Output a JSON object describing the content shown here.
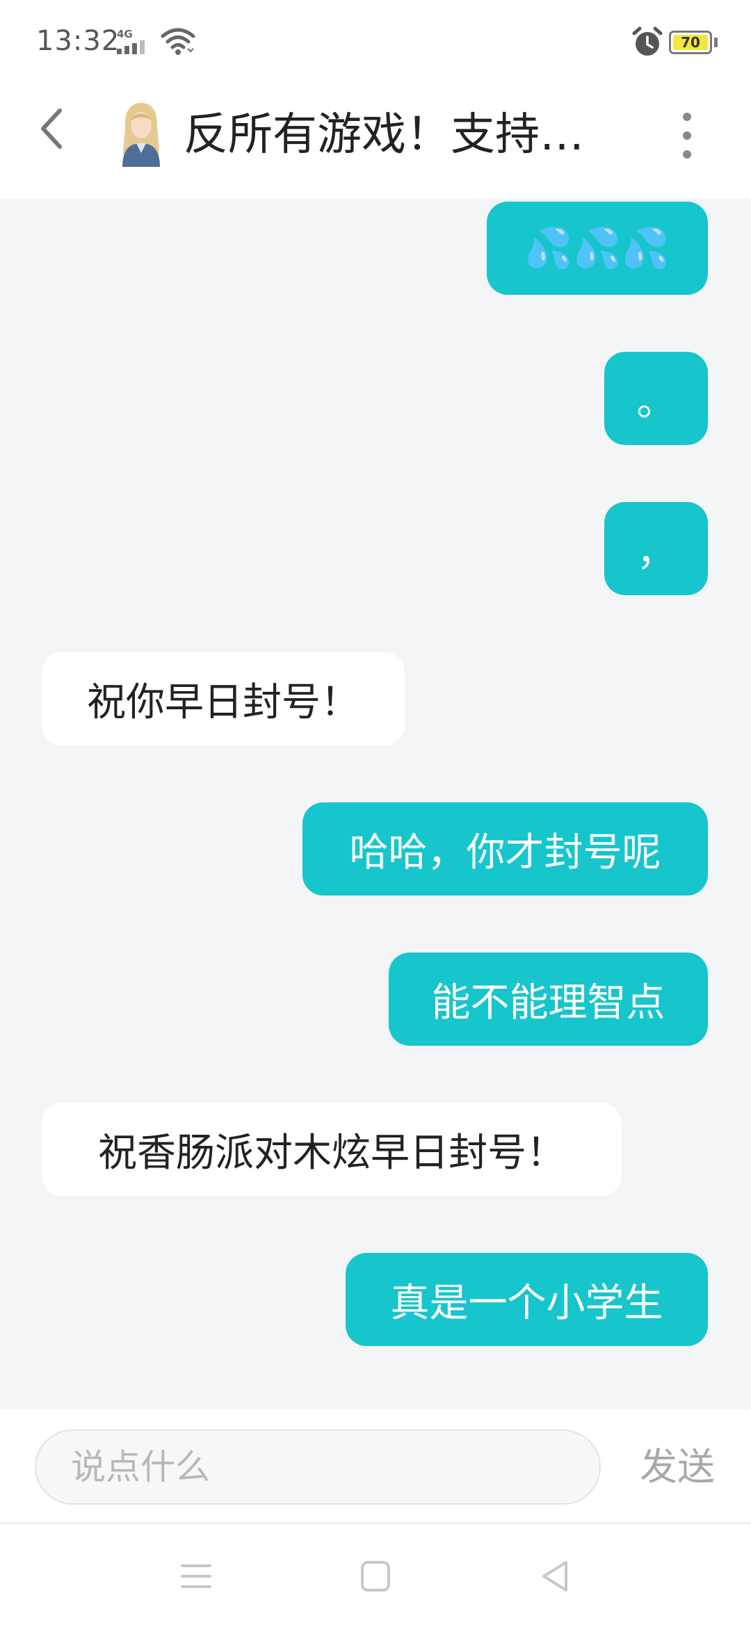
{
  "status_bar": {
    "time": "13:32",
    "network_type": "4G",
    "battery_level": "70",
    "icons": [
      "signal-icon",
      "wifi-icon",
      "alarm-icon",
      "battery-icon"
    ]
  },
  "header": {
    "title": "反所有游戏！支持…",
    "back_icon": "back-arrow-icon",
    "avatar": "anime-character-avatar",
    "more_icon": "more-vertical-icon"
  },
  "messages": [
    {
      "sender": "me",
      "text": "💦💦💦"
    },
    {
      "sender": "me",
      "text": "。"
    },
    {
      "sender": "me",
      "text": "，"
    },
    {
      "sender": "other",
      "text": "祝你早日封号！"
    },
    {
      "sender": "me",
      "text": "哈哈，你才封号呢"
    },
    {
      "sender": "me",
      "text": "能不能理智点"
    },
    {
      "sender": "other",
      "text": "祝香肠派对木炫早日封号！"
    },
    {
      "sender": "me",
      "text": "真是一个小学生"
    }
  ],
  "input_bar": {
    "placeholder": "说点什么",
    "send_label": "发送"
  },
  "nav_bar": {
    "icons": [
      "menu-icon",
      "home-square-icon",
      "back-triangle-icon"
    ]
  },
  "colors": {
    "my_bubble": "#17c5cc",
    "other_bubble": "#ffffff",
    "chat_background": "#f4f5f7",
    "battery_fill": "#f3e641"
  }
}
